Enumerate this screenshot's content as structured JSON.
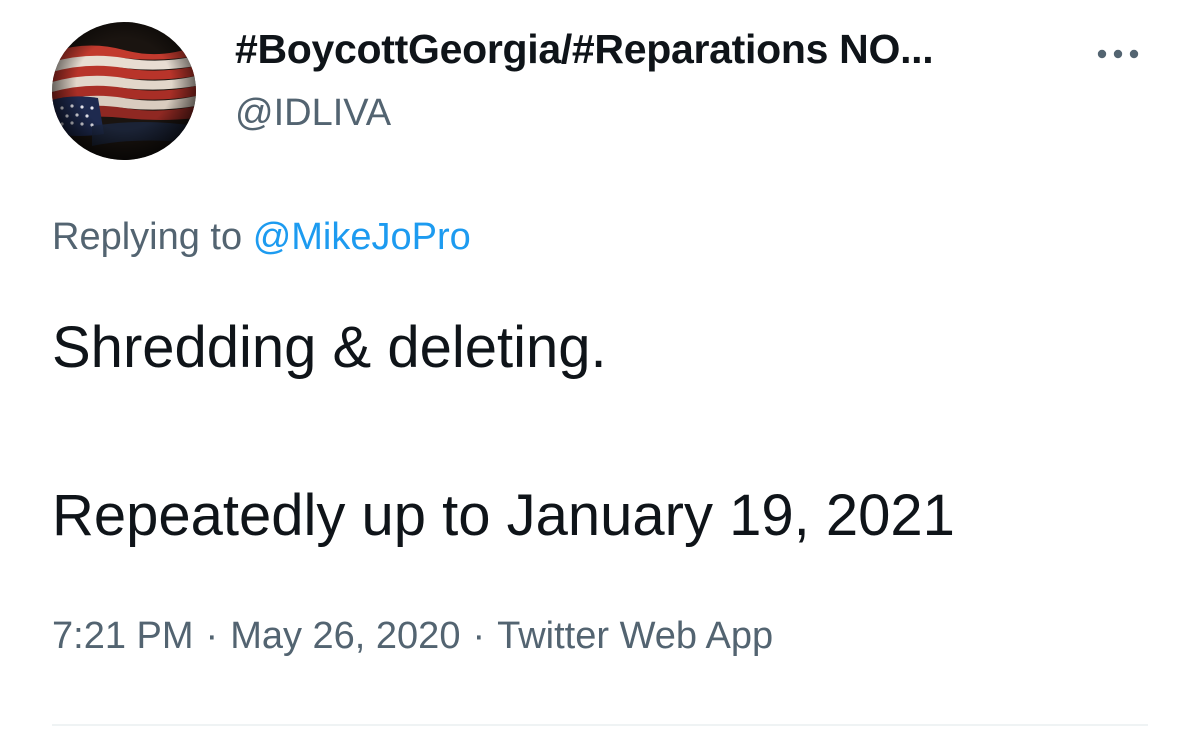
{
  "tweet": {
    "author": {
      "display_name": "#BoycottGeorgia/#Reparations NO...",
      "handle": "@IDLIVA",
      "avatar_icon": "waving-us-flag-avatar"
    },
    "more_icon": "more-horizontal-icon",
    "reply": {
      "prefix": "Replying to",
      "mention": "@MikeJoPro"
    },
    "text": {
      "line1": "Shredding & deleting.",
      "line2": "Repeatedly up to January 19, 2021"
    },
    "meta": {
      "time": "7:21 PM",
      "separator": "·",
      "date": "May 26, 2020",
      "source": "Twitter Web App"
    }
  },
  "colors": {
    "text_primary": "#0f1419",
    "text_secondary": "#536471",
    "link": "#1d9bf0",
    "divider": "#eff3f4"
  }
}
